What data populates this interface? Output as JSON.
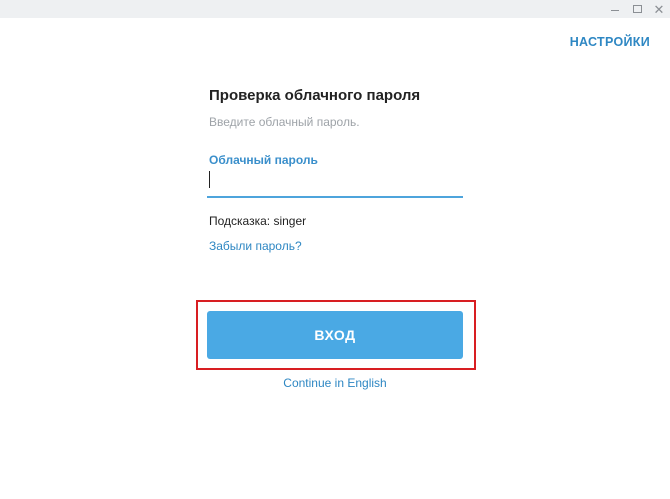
{
  "window": {
    "minimize_icon": "minimize-icon",
    "maximize_icon": "maximize-icon",
    "close_icon": "close-icon",
    "close_glyph": "✕"
  },
  "header": {
    "settings_label": "НАСТРОЙКИ"
  },
  "form": {
    "title": "Проверка облачного пароля",
    "subtitle": "Введите облачный пароль.",
    "password_label": "Облачный пароль",
    "password_value": "",
    "hint": "Подсказка: singer",
    "forgot_password": "Забыли пароль?",
    "submit_label": "ВХОД",
    "continue_english": "Continue in English"
  },
  "colors": {
    "accent": "#2e87c3",
    "button": "#4aa9e4",
    "highlight": "#d81e22"
  }
}
